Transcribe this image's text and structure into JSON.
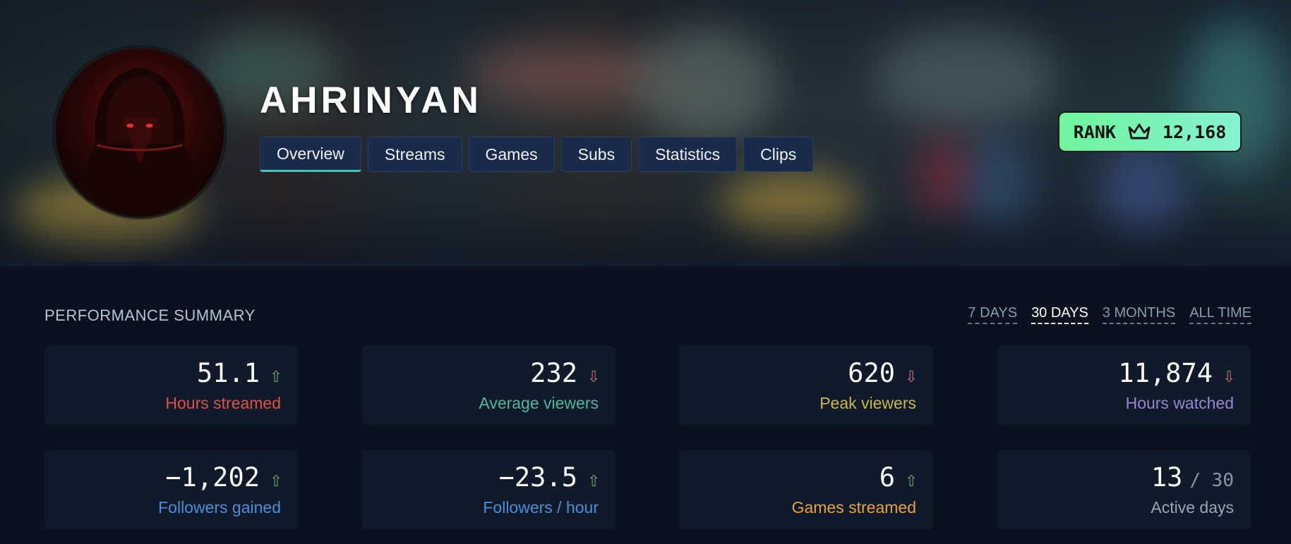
{
  "header": {
    "streamer_name": "AHRINYAN",
    "tabs": [
      {
        "label": "Overview",
        "active": true
      },
      {
        "label": "Streams",
        "active": false
      },
      {
        "label": "Games",
        "active": false
      },
      {
        "label": "Subs",
        "active": false
      },
      {
        "label": "Statistics",
        "active": false
      },
      {
        "label": "Clips",
        "active": false
      }
    ],
    "rank": {
      "label": "RANK",
      "icon": "crown-icon",
      "value": "12,168"
    }
  },
  "summary": {
    "title": "PERFORMANCE SUMMARY",
    "ranges": [
      {
        "label": "7 DAYS",
        "active": false
      },
      {
        "label": "30 DAYS",
        "active": true
      },
      {
        "label": "3 MONTHS",
        "active": false
      },
      {
        "label": "ALL TIME",
        "active": false
      }
    ],
    "stats": [
      {
        "value": "51.1",
        "trend": "up",
        "label": "Hours streamed",
        "color": "#e0504a"
      },
      {
        "value": "232",
        "trend": "down",
        "label": "Average viewers",
        "color": "#4fb89a"
      },
      {
        "value": "620",
        "trend": "down",
        "label": "Peak viewers",
        "color": "#c7b84a"
      },
      {
        "value": "11,874",
        "trend": "down",
        "label": "Hours watched",
        "color": "#9a86cf"
      },
      {
        "value": "−1,202",
        "trend": "up",
        "label": "Followers gained",
        "color": "#4a8fd6"
      },
      {
        "value": "−23.5",
        "trend": "up",
        "label": "Followers / hour",
        "color": "#4a8fd6"
      },
      {
        "value": "6",
        "trend": "up",
        "label": "Games streamed",
        "color": "#e8a23a"
      },
      {
        "value": "13",
        "denominator": "/ 30",
        "trend": "none",
        "label": "Active days",
        "color": "#9aa4b3"
      }
    ]
  },
  "colors": {
    "accent": "#3ec7b4",
    "rank_badge_start": "#6ef59c",
    "rank_badge_end": "#86f1d2",
    "trend_up": "#6aa572",
    "trend_down": "#c2706c"
  }
}
